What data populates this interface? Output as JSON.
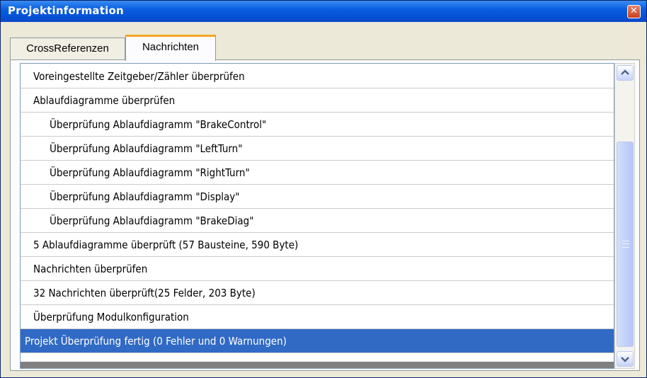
{
  "window": {
    "title": "Projektinformation",
    "close_glyph": "✕"
  },
  "tabs": [
    {
      "label": "CrossReferenzen",
      "active": false
    },
    {
      "label": "Nachrichten",
      "active": true
    }
  ],
  "messages": [
    {
      "text": "Voreingestellte Zeitgeber/Zähler überprüfen",
      "indent": false,
      "selected": false
    },
    {
      "text": "Ablaufdiagramme überprüfen",
      "indent": false,
      "selected": false
    },
    {
      "text": "Überprüfung Ablaufdiagramm \"BrakeControl\"",
      "indent": true,
      "selected": false
    },
    {
      "text": "Überprüfung Ablaufdiagramm \"LeftTurn\"",
      "indent": true,
      "selected": false
    },
    {
      "text": "Überprüfung Ablaufdiagramm \"RightTurn\"",
      "indent": true,
      "selected": false
    },
    {
      "text": "Überprüfung Ablaufdiagramm \"Display\"",
      "indent": true,
      "selected": false
    },
    {
      "text": "Überprüfung Ablaufdiagramm \"BrakeDiag\"",
      "indent": true,
      "selected": false
    },
    {
      "text": "5 Ablaufdiagramme überprüft (57 Bausteine, 590 Byte)",
      "indent": false,
      "selected": false
    },
    {
      "text": "Nachrichten überprüfen",
      "indent": false,
      "selected": false
    },
    {
      "text": "32 Nachrichten überprüft(25 Felder, 203 Byte)",
      "indent": false,
      "selected": false
    },
    {
      "text": "Überprüfung Modulkonfiguration",
      "indent": false,
      "selected": false
    },
    {
      "text": "Projekt Überprüfung fertig (0 Fehler und 0 Warnungen)",
      "indent": false,
      "selected": true
    }
  ],
  "scrollbar": {
    "up_icon": "scroll-up-arrow-icon",
    "down_icon": "scroll-down-arrow-icon",
    "position": 1.0
  },
  "colors": {
    "titlebar": "#0a5ee0",
    "selection": "#316ac5",
    "active_tab_accent": "#f5a623"
  }
}
